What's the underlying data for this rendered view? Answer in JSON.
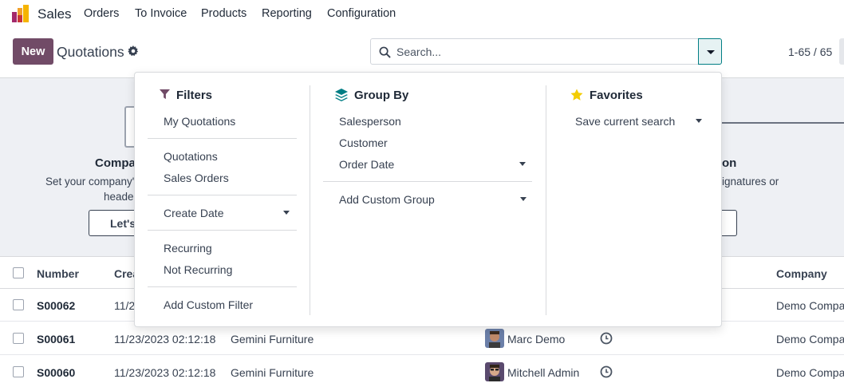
{
  "app": {
    "name": "Sales"
  },
  "nav": [
    "Orders",
    "To Invoice",
    "Products",
    "Reporting",
    "Configuration"
  ],
  "control": {
    "new_label": "New",
    "title": "Quotations",
    "search_placeholder": "Search...",
    "pager": "1-65 / 65"
  },
  "banner": {
    "left_title": "Compa",
    "left_text1": "Set your company's",
    "left_text2": "header",
    "left_button": "Let's",
    "right_title": "on",
    "right_text": "ignatures or"
  },
  "table": {
    "headers": [
      "Number",
      "Crea",
      "Company"
    ],
    "rows": [
      {
        "number": "S00062",
        "date": "11/2",
        "customer": "",
        "salesperson": "",
        "company": "Demo Compa"
      },
      {
        "number": "S00061",
        "date": "11/23/2023 02:12:18",
        "customer": "Gemini Furniture",
        "salesperson": "Marc Demo",
        "company": "Demo Compa"
      },
      {
        "number": "S00060",
        "date": "11/23/2023 02:12:18",
        "customer": "Gemini Furniture",
        "salesperson": "Mitchell Admin",
        "company": "Demo Compa"
      }
    ]
  },
  "dropdown": {
    "filters": {
      "title": "Filters",
      "items": [
        "My Quotations",
        "Quotations",
        "Sales Orders",
        "Create Date",
        "Recurring",
        "Not Recurring",
        "Add Custom Filter"
      ]
    },
    "group_by": {
      "title": "Group By",
      "items": [
        "Salesperson",
        "Customer",
        "Order Date",
        "Add Custom Group"
      ]
    },
    "favorites": {
      "title": "Favorites",
      "items": [
        "Save current search"
      ]
    }
  },
  "colors": {
    "primary": "#714b67",
    "accent": "#017e84",
    "star": "#f3cc00"
  }
}
